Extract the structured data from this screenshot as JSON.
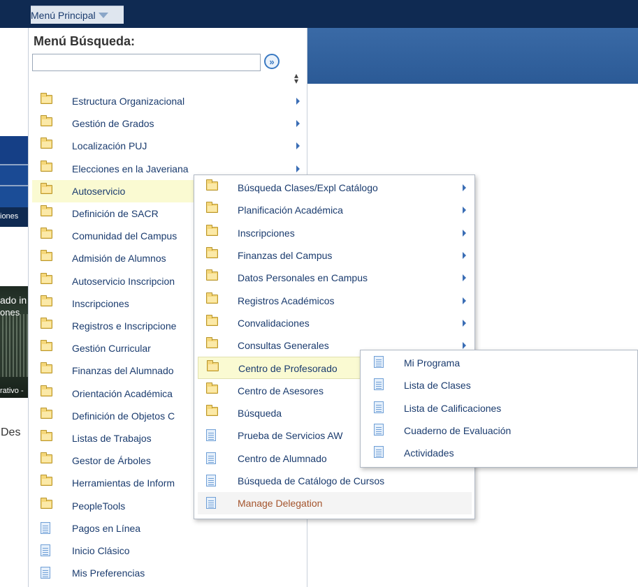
{
  "header": {
    "menu_button_label": "Menú Principal"
  },
  "background": {
    "strip_text": "iones",
    "photo_text_1": "ado in",
    "photo_text_2": "ones",
    "photo_caption": "rativo -",
    "des_text": "Des"
  },
  "search": {
    "title": "Menú Búsqueda:",
    "value": "",
    "placeholder": ""
  },
  "menu": {
    "items": [
      {
        "label": "Estructura Organizacional",
        "icon": "folder-icon",
        "has_submenu": true
      },
      {
        "label": "Gestión de Grados",
        "icon": "folder-icon",
        "has_submenu": true
      },
      {
        "label": "Localización PUJ",
        "icon": "folder-icon",
        "has_submenu": true
      },
      {
        "label": "Elecciones en la Javeriana",
        "icon": "folder-icon",
        "has_submenu": true
      },
      {
        "label": "Autoservicio",
        "icon": "folder-icon",
        "has_submenu": true,
        "highlighted": true
      },
      {
        "label": "Definición de SACR",
        "icon": "folder-icon"
      },
      {
        "label": "Comunidad del Campus",
        "icon": "folder-icon"
      },
      {
        "label": "Admisión de Alumnos",
        "icon": "folder-icon"
      },
      {
        "label": "Autoservicio Inscripcion",
        "icon": "folder-icon"
      },
      {
        "label": "Inscripciones",
        "icon": "folder-icon"
      },
      {
        "label": "Registros e Inscripcione",
        "icon": "folder-icon"
      },
      {
        "label": "Gestión Curricular",
        "icon": "folder-icon"
      },
      {
        "label": "Finanzas del Alumnado",
        "icon": "folder-icon"
      },
      {
        "label": "Orientación Académica",
        "icon": "folder-icon"
      },
      {
        "label": "Definición de Objetos C",
        "icon": "folder-icon"
      },
      {
        "label": "Listas de Trabajos",
        "icon": "folder-icon"
      },
      {
        "label": "Gestor de Árboles",
        "icon": "folder-icon"
      },
      {
        "label": "Herramientas de Inform",
        "icon": "folder-icon"
      },
      {
        "label": "PeopleTools",
        "icon": "folder-icon"
      },
      {
        "label": "Pagos en Línea",
        "icon": "page-icon"
      },
      {
        "label": "Inicio Clásico",
        "icon": "page-icon"
      },
      {
        "label": "Mis Preferencias",
        "icon": "page-icon"
      }
    ]
  },
  "submenu_autoservicio": {
    "items": [
      {
        "label": "Búsqueda Clases/Expl Catálogo",
        "icon": "folder-icon",
        "has_submenu": true
      },
      {
        "label": "Planificación Académica",
        "icon": "folder-icon",
        "has_submenu": true
      },
      {
        "label": "Inscripciones",
        "icon": "folder-icon",
        "has_submenu": true
      },
      {
        "label": "Finanzas del Campus",
        "icon": "folder-icon",
        "has_submenu": true
      },
      {
        "label": "Datos Personales en Campus",
        "icon": "folder-icon",
        "has_submenu": true
      },
      {
        "label": "Registros Académicos",
        "icon": "folder-icon",
        "has_submenu": true
      },
      {
        "label": "Convalidaciones",
        "icon": "folder-icon",
        "has_submenu": true
      },
      {
        "label": "Consultas Generales",
        "icon": "folder-icon",
        "has_submenu": true
      },
      {
        "label": "Centro de Profesorado",
        "icon": "folder-icon",
        "selected": true
      },
      {
        "label": "Centro de Asesores",
        "icon": "folder-icon"
      },
      {
        "label": "Búsqueda",
        "icon": "folder-icon"
      },
      {
        "label": "Prueba de Servicios AW",
        "icon": "page-icon"
      },
      {
        "label": "Centro de Alumnado",
        "icon": "page-icon"
      },
      {
        "label": "Búsqueda de Catálogo de Cursos",
        "icon": "page-icon"
      },
      {
        "label": "Manage Delegation",
        "icon": "page-icon",
        "hovered": true
      }
    ]
  },
  "submenu_profesorado": {
    "items": [
      {
        "label": "Mi Programa",
        "icon": "page-icon"
      },
      {
        "label": "Lista de Clases",
        "icon": "page-icon"
      },
      {
        "label": "Lista de Calificaciones",
        "icon": "page-icon"
      },
      {
        "label": "Cuaderno de Evaluación",
        "icon": "page-icon"
      },
      {
        "label": "Actividades",
        "icon": "page-icon"
      }
    ]
  },
  "colors": {
    "topbar": "#0f2a52",
    "banner": "#2b5a96",
    "link_text": "#1a3b6e",
    "highlight": "#fafad2",
    "hover_text": "#a4542c"
  }
}
